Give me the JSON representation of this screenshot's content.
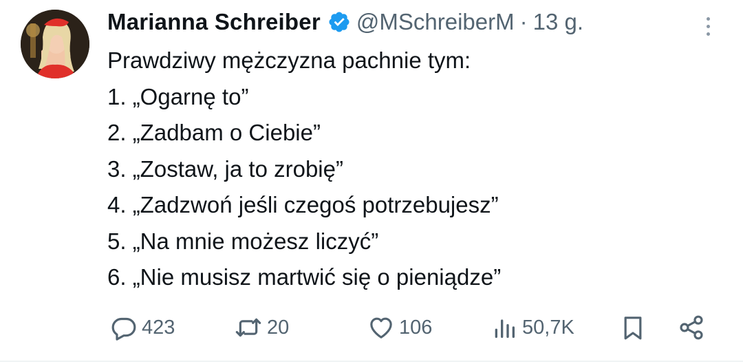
{
  "author": {
    "name": "Marianna Schreiber",
    "handle": "@MSchreiberM",
    "separator": "·",
    "time": "13 g."
  },
  "icons": {
    "verified": "verified-badge-icon",
    "more": "more-vertical-icon",
    "reply": "reply-icon",
    "repost": "repost-icon",
    "like": "like-icon",
    "views": "views-icon",
    "bookmark": "bookmark-icon",
    "share": "share-icon"
  },
  "colors": {
    "verified": "#1d9bf0",
    "text": "#0f1419",
    "secondary": "#536471"
  },
  "tweet": {
    "lines": [
      "Prawdziwy mężczyzna pachnie tym:",
      "1. „Ogarnę to”",
      "2. „Zadbam o Ciebie”",
      "3. „Zostaw, ja to zrobię”",
      "4. „Zadzwoń jeśli czegoś potrzebujesz”",
      "5. „Na mnie możesz liczyć”",
      "6. „Nie musisz martwić się o pieniądze”"
    ]
  },
  "stats": {
    "replies": "423",
    "reposts": "20",
    "likes": "106",
    "views": "50,7K"
  }
}
